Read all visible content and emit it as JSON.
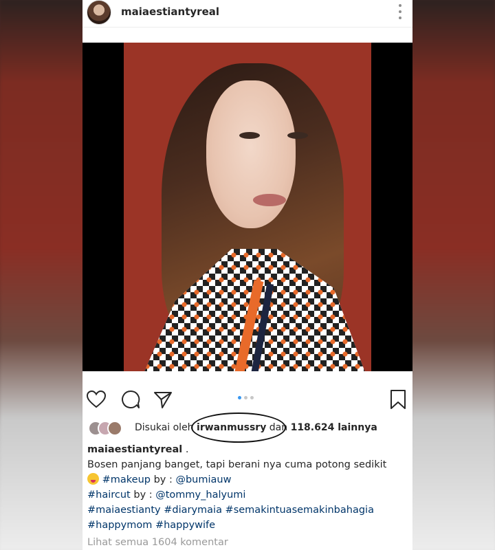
{
  "post": {
    "username": "maiaestiantyreal"
  },
  "actions": {
    "carousel_total": 3,
    "carousel_active": 1
  },
  "likes": {
    "prefix": "Disukai oleh ",
    "liker": "irwanmussry",
    "middle": " dan ",
    "count": "118.624 lainnya"
  },
  "caption": {
    "username": "maiaestiantyreal",
    "after_user": " .",
    "line1": "Bosen panjang banget, tapi berani nya cuma potong sedikit",
    "makeup_tag": "#makeup",
    "makeup_by": " by : ",
    "makeup_user": "@bumiauw",
    "haircut_tag": "#haircut",
    "haircut_by": " by : ",
    "haircut_user": "@tommy_halyumi",
    "tags_line": "#maiaestianty #diarymaia #semakintuasemakinbahagia",
    "tags_line2": "#happymom #happywife"
  },
  "comments": {
    "view_all": "Lihat semua 1604 komentar"
  },
  "colors": {
    "link": "#003569",
    "muted": "#999999",
    "active_dot": "#3897f0"
  }
}
